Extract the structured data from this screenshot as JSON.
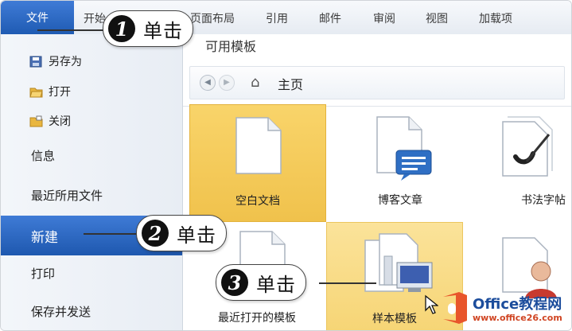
{
  "ribbon": {
    "tabs": [
      "文件",
      "开始",
      "页面布局",
      "引用",
      "邮件",
      "审阅",
      "视图",
      "加载项"
    ]
  },
  "backstage": {
    "top_items": [
      "另存为",
      "打开",
      "关闭"
    ],
    "nav_items": [
      "信息",
      "最近所用文件",
      "新建",
      "打印",
      "保存并发送"
    ],
    "selected": "新建"
  },
  "main": {
    "section_title": "可用模板",
    "home_label": "主页",
    "templates": [
      {
        "label": "空白文档",
        "icon": "blank-doc-icon"
      },
      {
        "label": "博客文章",
        "icon": "blog-doc-icon"
      },
      {
        "label": "书法字帖",
        "icon": "calligraphy-doc-icon"
      },
      {
        "label": "最近打开的模板",
        "icon": "recent-doc-icon"
      },
      {
        "label": "样本模板",
        "icon": "sample-doc-icon"
      },
      {
        "label": "",
        "icon": "my-template-icon"
      }
    ]
  },
  "callouts": [
    {
      "number": "1",
      "text": "单击"
    },
    {
      "number": "2",
      "text": "单击"
    },
    {
      "number": "3",
      "text": "单击"
    }
  ],
  "watermark": {
    "line1": "Office教程网",
    "line2": "www.office26.com"
  },
  "colors": {
    "accent": "#2a66c2",
    "tile_selected": "#f3c851",
    "tile_hover": "#f7d97d"
  }
}
